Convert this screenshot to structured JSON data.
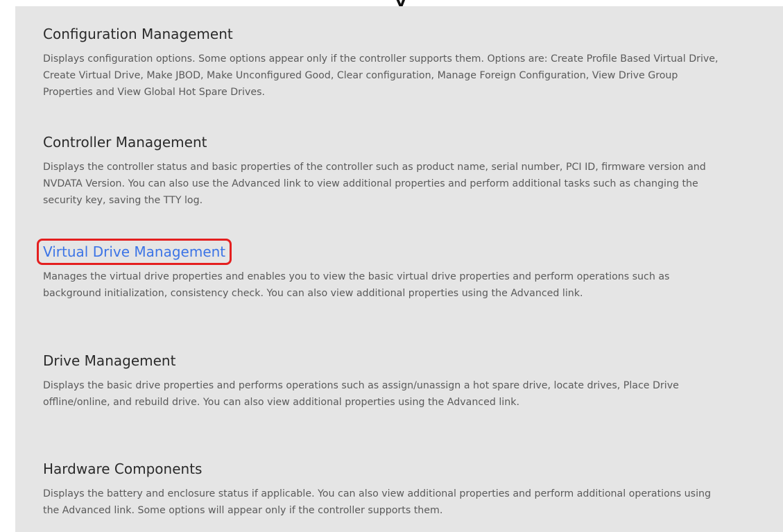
{
  "header_clip": "y",
  "sections": [
    {
      "title": "Configuration Management",
      "description": "Displays configuration options. Some options appear only if the controller supports them. Options are: Create Profile Based Virtual Drive, Create Virtual Drive, Make JBOD, Make Unconfigured Good, Clear configuration, Manage Foreign Configuration, View Drive Group Properties and View Global Hot Spare Drives."
    },
    {
      "title": "Controller Management",
      "description": "Displays the controller status and basic properties of the controller such as product name, serial number, PCI ID, firmware version and NVDATA Version. You can also use the Advanced link to view additional properties and perform additional tasks such as changing the security key, saving the TTY log."
    },
    {
      "title": "Virtual Drive Management",
      "description": "Manages the virtual drive properties and enables you to view the basic virtual drive properties and perform operations such as background initialization, consistency check. You can also view additional properties using the Advanced link.",
      "selected": true,
      "link_color": "#3c74e6",
      "highlight_color": "#e41f1f"
    },
    {
      "title": "Drive Management",
      "description": "Displays the basic drive properties and performs operations such as assign/unassign a hot spare drive, locate drives, Place Drive offline/online, and rebuild drive. You can also view additional properties using the Advanced link."
    },
    {
      "title": "Hardware Components",
      "description": "Displays the battery and enclosure status if applicable. You can also view additional properties and perform additional operations using the Advanced link. Some options will appear only if the controller supports them."
    }
  ],
  "colors": {
    "background": "#e5e5e5",
    "title_text": "#2a2a2a",
    "body_text": "#5a5a5a"
  }
}
